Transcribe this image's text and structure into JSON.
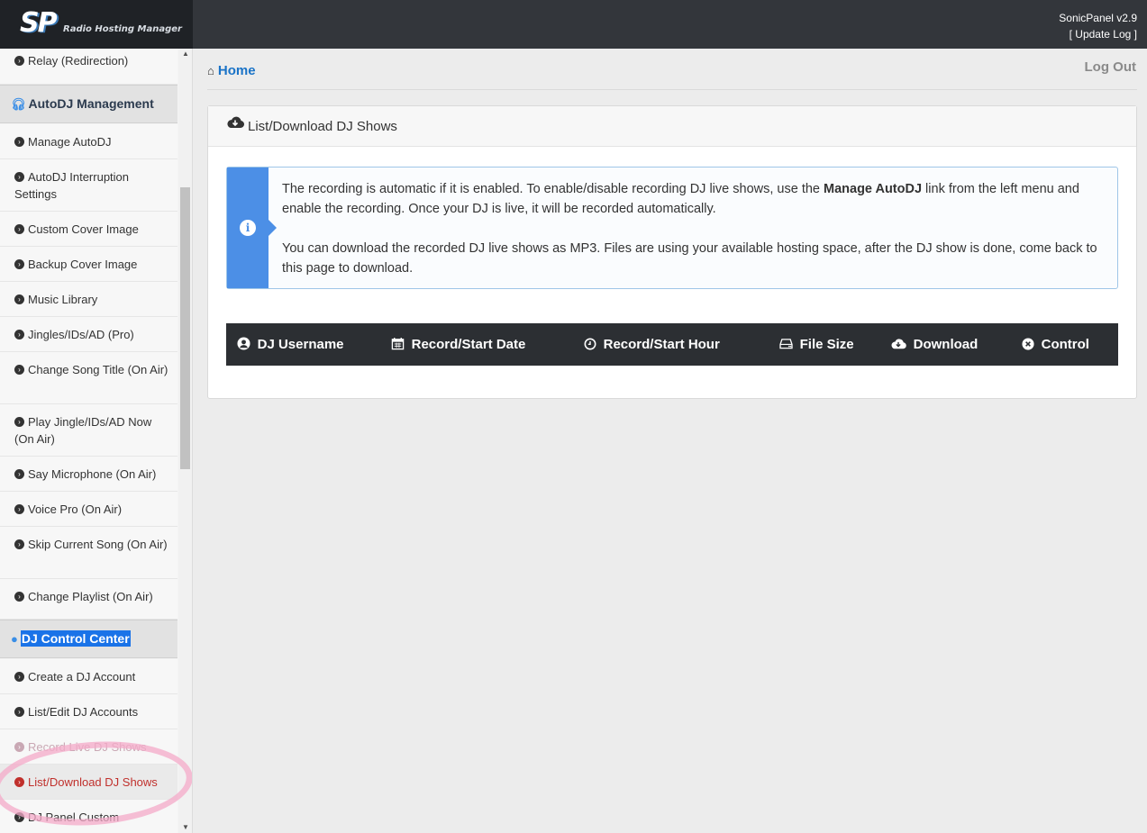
{
  "header": {
    "logo_mark": "SP",
    "logo_text": "Radio Hosting Manager",
    "version": "SonicPanel v2.9",
    "update_log": "[ Update Log ]"
  },
  "sidebar": {
    "items": [
      {
        "label": "Relay (Redirection)"
      },
      {
        "label": "Manage AutoDJ"
      },
      {
        "label": "AutoDJ Interruption Settings"
      },
      {
        "label": "Custom Cover Image"
      },
      {
        "label": "Backup Cover Image"
      },
      {
        "label": "Music Library"
      },
      {
        "label": "Jingles/IDs/AD (Pro)"
      },
      {
        "label": "Change Song Title (On Air)"
      },
      {
        "label": "Play Jingle/IDs/AD Now (On Air)"
      },
      {
        "label": "Say Microphone (On Air)"
      },
      {
        "label": "Voice Pro (On Air)"
      },
      {
        "label": "Skip Current Song (On Air)"
      },
      {
        "label": "Change Playlist (On Air)"
      },
      {
        "label": "Create a DJ Account"
      },
      {
        "label": "List/Edit DJ Accounts"
      },
      {
        "label": "Record Live DJ Shows"
      },
      {
        "label": "List/Download DJ Shows"
      },
      {
        "label": "DJ Panel Custom"
      }
    ],
    "sections": {
      "autodj": "AutoDJ Management",
      "djcenter": "DJ Control Center"
    }
  },
  "main": {
    "breadcrumb": "Home",
    "logout": "Log Out",
    "panel_title": "List/Download DJ Shows",
    "alert": {
      "p1_before": "The recording is automatic if it is enabled. To enable/disable recording DJ live shows, use the ",
      "p1_bold": "Manage AutoDJ",
      "p1_after": " link from the left menu and enable the recording. Once your DJ is live, it will be recorded automatically.",
      "p2": "You can download the recorded DJ live shows as MP3. Files are using your available hosting space, after the DJ show is done, come back to this page to download."
    },
    "table": {
      "columns": [
        {
          "label": "DJ Username",
          "icon": "user-circle-icon"
        },
        {
          "label": "Record/Start Date",
          "icon": "calendar-icon"
        },
        {
          "label": "Record/Start Hour",
          "icon": "clock-icon"
        },
        {
          "label": "File Size",
          "icon": "hdd-icon"
        },
        {
          "label": "Download",
          "icon": "cloud-download-icon"
        },
        {
          "label": "Control",
          "icon": "times-circle-icon"
        }
      ]
    }
  },
  "colors": {
    "topbar": "#33363b",
    "accent_blue": "#1a73c7",
    "info_blue": "#4c8fe6",
    "active_red": "#c0302c",
    "table_head": "#2c2f33"
  }
}
